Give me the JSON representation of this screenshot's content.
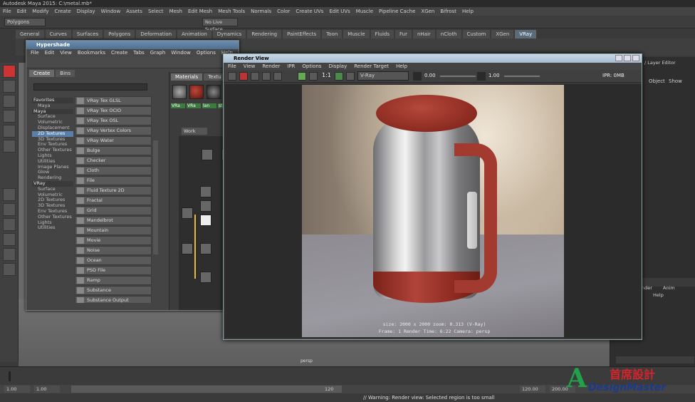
{
  "window": {
    "title": "Autodesk Maya 2015: C:\\metal.mb*"
  },
  "menubar": [
    "File",
    "Edit",
    "Modify",
    "Create",
    "Display",
    "Window",
    "Assets",
    "Select",
    "Mesh",
    "Edit Mesh",
    "Mesh Tools",
    "Normals",
    "Color",
    "Create UVs",
    "Edit UVs",
    "Muscle",
    "Pipeline Cache",
    "XGen",
    "Bifrost",
    "Help"
  ],
  "statusline": {
    "mode": "Polygons",
    "live": "No Live Surface"
  },
  "shelf_tabs": [
    "General",
    "Curves",
    "Surfaces",
    "Polygons",
    "Deformation",
    "Animation",
    "Dynamics",
    "Rendering",
    "PaintEffects",
    "Toon",
    "Muscle",
    "Fluids",
    "Fur",
    "nHair",
    "nCloth",
    "Custom",
    "XGen",
    "VRay"
  ],
  "hypershade": {
    "title": "Hypershade",
    "menu": [
      "File",
      "Edit",
      "View",
      "Bookmarks",
      "Create",
      "Tabs",
      "Graph",
      "Window",
      "Options",
      "Help"
    ],
    "tabs": [
      "Create",
      "Bins"
    ],
    "mat_tabs": [
      "Materials",
      "Textu"
    ],
    "workarea": "Work Area",
    "tree": [
      {
        "label": "Favorites",
        "hdr": true
      },
      {
        "label": "Maya",
        "hdr": false
      },
      {
        "label": "Maya",
        "hdr": true
      },
      {
        "label": "Surface"
      },
      {
        "label": "Volumetric"
      },
      {
        "label": "Displacement"
      },
      {
        "label": "2D Textures",
        "sel": true
      },
      {
        "label": "3D Textures"
      },
      {
        "label": "Env Textures"
      },
      {
        "label": "Other Textures"
      },
      {
        "label": "Lights"
      },
      {
        "label": "Utilities"
      },
      {
        "label": "Image Planes"
      },
      {
        "label": "Glow"
      },
      {
        "label": "Rendering"
      },
      {
        "label": "VRay",
        "hdr": true
      },
      {
        "label": "Surface"
      },
      {
        "label": "Volumetric"
      },
      {
        "label": "2D Textures"
      },
      {
        "label": "3D Textures"
      },
      {
        "label": "Env Textures"
      },
      {
        "label": "Other Textures"
      },
      {
        "label": "Lights"
      },
      {
        "label": "Utilities"
      }
    ],
    "nodes": [
      "VRay Tex GLSL",
      "VRay Tex OCIO",
      "VRay Tex OSL",
      "VRay Vertex Colors",
      "VRay Water",
      "Bulge",
      "Checker",
      "Cloth",
      "File",
      "Fluid Texture 2D",
      "Fractal",
      "Grid",
      "Mandelbrot",
      "Mountain",
      "Movie",
      "Noise",
      "Ocean",
      "PSD File",
      "Ramp",
      "Substance",
      "Substance Output"
    ],
    "swatch_labels": [
      "VRa",
      "VRa",
      "lan",
      "sta"
    ]
  },
  "render_view": {
    "title": "Render View",
    "menu": [
      "File",
      "View",
      "Render",
      "IPR",
      "Options",
      "Display",
      "Render Target",
      "Help"
    ],
    "renderer": "V-Ray",
    "exposure": "0.00",
    "gamma": "1.00",
    "ratio": "1:1",
    "ipr": "IPR: 0MB",
    "info_line1": "size: 2000 x 2000  zoom: 0.313        (V-Ray)",
    "info_line2": "Frame: 1        Render Time: 6:22        Camera: persp"
  },
  "right_panel": {
    "layer_editor": "/ Layer Editor",
    "object": "Object",
    "show": "Show",
    "tab_render": "nder",
    "tab_anim": "Anim",
    "help": "Help"
  },
  "viewport": {
    "label": "persp"
  },
  "timeline": {
    "start": "1.00",
    "start2": "1.00",
    "end": "120",
    "end1": "120.00",
    "end2": "200.00"
  },
  "helpline": "// Warning: Render view: Selected region is too small",
  "logo": {
    "cn": "首席設計",
    "en": "DesignMaster",
    "letter": "A"
  }
}
